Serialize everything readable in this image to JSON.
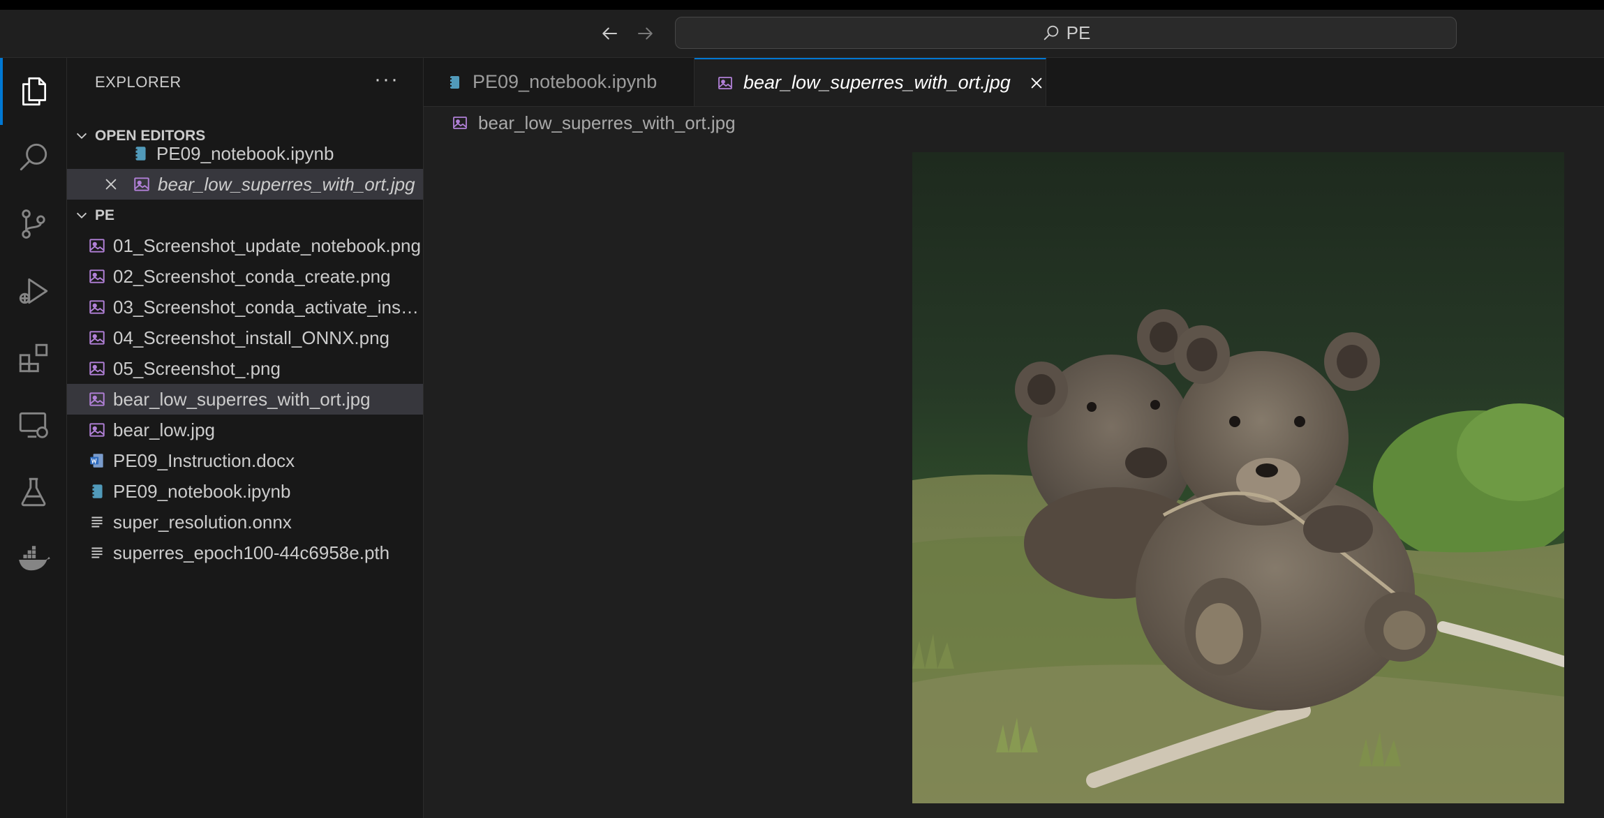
{
  "titlebar": {
    "search_text": "PE"
  },
  "sidebar": {
    "title": "EXPLORER",
    "more": "···",
    "open_editors": {
      "label": "OPEN EDITORS",
      "items": [
        {
          "label": "PE09_notebook.ipynb",
          "icon": "notebook-icon"
        },
        {
          "label": "bear_low_superres_with_ort.jpg",
          "icon": "image-file-icon"
        }
      ]
    },
    "folder": {
      "label": "PE",
      "items": [
        {
          "label": "01_Screenshot_update_notebook.png",
          "icon": "image-file-icon"
        },
        {
          "label": "02_Screenshot_conda_create.png",
          "icon": "image-file-icon"
        },
        {
          "label": "03_Screenshot_conda_activate_install.png",
          "icon": "image-file-icon"
        },
        {
          "label": "04_Screenshot_install_ONNX.png",
          "icon": "image-file-icon"
        },
        {
          "label": "05_Screenshot_.png",
          "icon": "image-file-icon"
        },
        {
          "label": "bear_low_superres_with_ort.jpg",
          "icon": "image-file-icon"
        },
        {
          "label": "bear_low.jpg",
          "icon": "image-file-icon"
        },
        {
          "label": "PE09_Instruction.docx",
          "icon": "word-file-icon"
        },
        {
          "label": "PE09_notebook.ipynb",
          "icon": "notebook-icon"
        },
        {
          "label": "super_resolution.onnx",
          "icon": "text-file-icon"
        },
        {
          "label": "superres_epoch100-44c6958e.pth",
          "icon": "text-file-icon"
        }
      ]
    }
  },
  "editor": {
    "tabs": [
      {
        "label": "PE09_notebook.ipynb",
        "icon": "notebook-icon"
      },
      {
        "label": "bear_low_superres_with_ort.jpg",
        "icon": "image-file-icon"
      }
    ],
    "breadcrumb": "bear_low_superres_with_ort.jpg"
  },
  "colors": {
    "accent": "#0078d4",
    "image_icon": "#b180d7",
    "notebook_icon": "#519aba",
    "word_icon": "#4b8fd4"
  }
}
